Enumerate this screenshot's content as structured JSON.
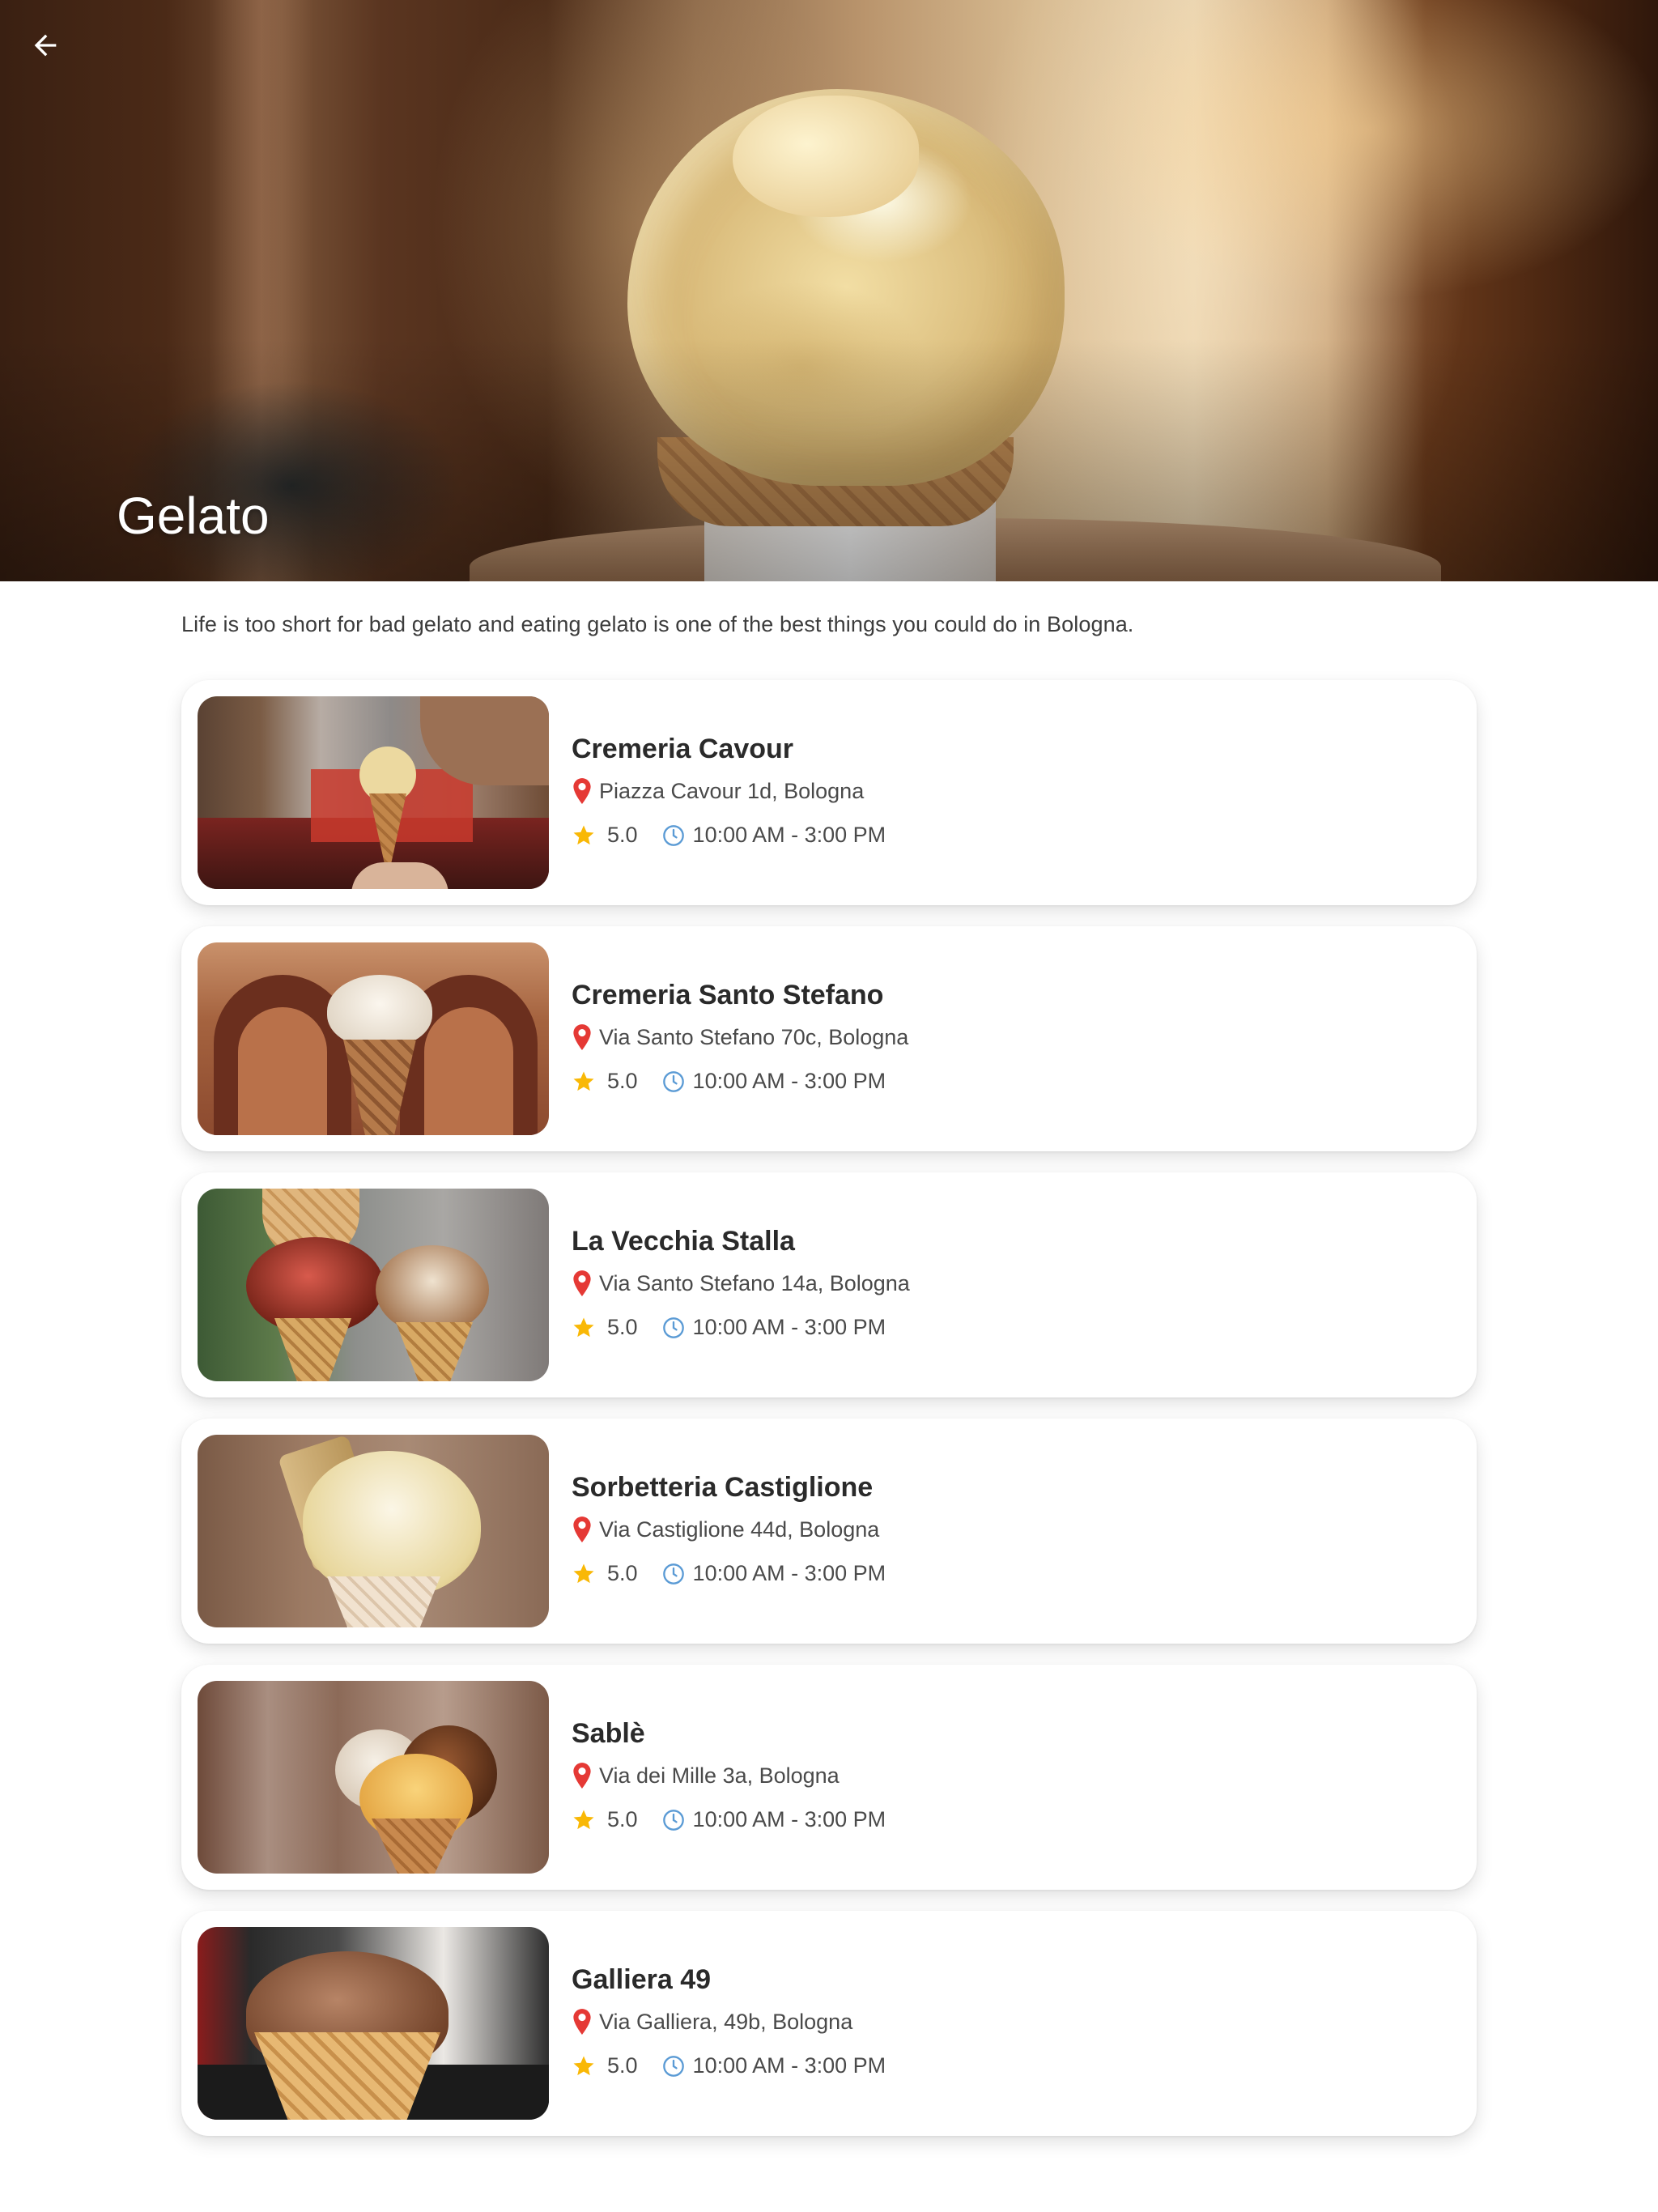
{
  "header": {
    "back_icon": "arrow-left-icon",
    "title": "Gelato"
  },
  "intro": "Life is too short for bad gelato and eating gelato is one of the best things you could do in Bologna.",
  "icons": {
    "address": "map-pin-icon",
    "rating": "star-icon",
    "hours": "clock-icon"
  },
  "colors": {
    "pin": "#E53935",
    "star": "#F9B806",
    "clock": "#5B9BD5"
  },
  "shops": [
    {
      "name": "Cremeria Cavour",
      "address": "Piazza Cavour 1d, Bologna",
      "rating": "5.0",
      "hours": "10:00 AM - 3:00 PM"
    },
    {
      "name": "Cremeria Santo Stefano",
      "address": "Via Santo Stefano 70c, Bologna",
      "rating": "5.0",
      "hours": "10:00 AM - 3:00 PM"
    },
    {
      "name": "La Vecchia Stalla",
      "address": "Via Santo Stefano 14a, Bologna",
      "rating": "5.0",
      "hours": "10:00 AM - 3:00 PM"
    },
    {
      "name": "Sorbetteria Castiglione",
      "address": "Via Castiglione 44d, Bologna",
      "rating": "5.0",
      "hours": "10:00 AM - 3:00 PM"
    },
    {
      "name": "Sablè",
      "address": "Via dei Mille 3a, Bologna",
      "rating": "5.0",
      "hours": "10:00 AM - 3:00 PM"
    },
    {
      "name": "Galliera 49",
      "address": "Via Galliera, 49b, Bologna",
      "rating": "5.0",
      "hours": "10:00 AM - 3:00 PM"
    }
  ]
}
